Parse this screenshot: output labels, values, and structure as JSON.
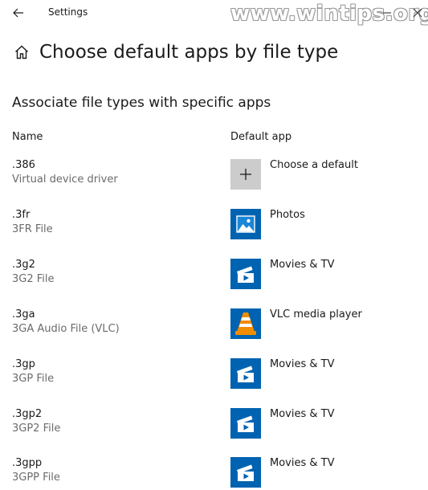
{
  "window": {
    "app_title": "Settings",
    "watermark": "www.wintips.org",
    "back_icon": "arrow-left-icon",
    "minimize_icon": "minimize-icon",
    "close_icon": "close-icon"
  },
  "header": {
    "home_icon": "home-icon",
    "title": "Choose default apps by file type"
  },
  "section": {
    "title": "Associate file types with specific apps"
  },
  "columns": {
    "name": "Name",
    "default_app": "Default app"
  },
  "rows": [
    {
      "extension": ".386",
      "description": "Virtual device driver",
      "app": "Choose a default",
      "icon": "plus-icon"
    },
    {
      "extension": ".3fr",
      "description": "3FR File",
      "app": "Photos",
      "icon": "photos-icon"
    },
    {
      "extension": ".3g2",
      "description": "3G2 File",
      "app": "Movies & TV",
      "icon": "movies-tv-icon"
    },
    {
      "extension": ".3ga",
      "description": "3GA Audio File (VLC)",
      "app": "VLC media player",
      "icon": "vlc-icon"
    },
    {
      "extension": ".3gp",
      "description": "3GP File",
      "app": "Movies & TV",
      "icon": "movies-tv-icon"
    },
    {
      "extension": ".3gp2",
      "description": "3GP2 File",
      "app": "Movies & TV",
      "icon": "movies-tv-icon"
    },
    {
      "extension": ".3gpp",
      "description": "3GPP File",
      "app": "Movies & TV",
      "icon": "movies-tv-icon"
    }
  ],
  "colors": {
    "accent_blue": "#0063b1",
    "choose_tile": "#cccccc",
    "vlc_orange": "#f28c00",
    "secondary_text": "#6b6b6b"
  }
}
